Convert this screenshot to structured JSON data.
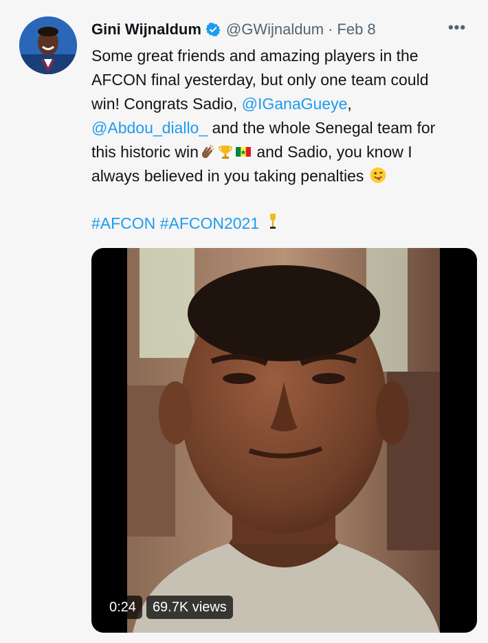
{
  "tweet": {
    "author_name": "Gini Wijnaldum",
    "handle": "@GWijnaldum",
    "separator": "·",
    "date": "Feb 8",
    "more_label": "•••",
    "text": {
      "l1": "Some great friends and amazing players in the",
      "l2": "AFCON final yesterday, but only one team could",
      "l3a": "win! Congrats Sadio, ",
      "l3m": "@IGanaGueye",
      "l3b": ",",
      "l4m": "@Abdou_diallo_",
      "l4b": " and the whole Senegal team for",
      "l5a": "this historic win",
      "l5b": " and Sadio, you know I",
      "l6": "always believed in you taking penalties"
    },
    "emojis": [
      "clapping-hands",
      "trophy",
      "senegal-flag",
      "winking-face-with-tongue",
      "trophy"
    ],
    "hashtags": [
      "#AFCON",
      "#AFCON2021"
    ],
    "video": {
      "duration": "0:24",
      "views": "69.7K views"
    }
  },
  "colors": {
    "link": "#1d9bf0",
    "secondary": "#536471",
    "verified": "#1d9bf0"
  }
}
